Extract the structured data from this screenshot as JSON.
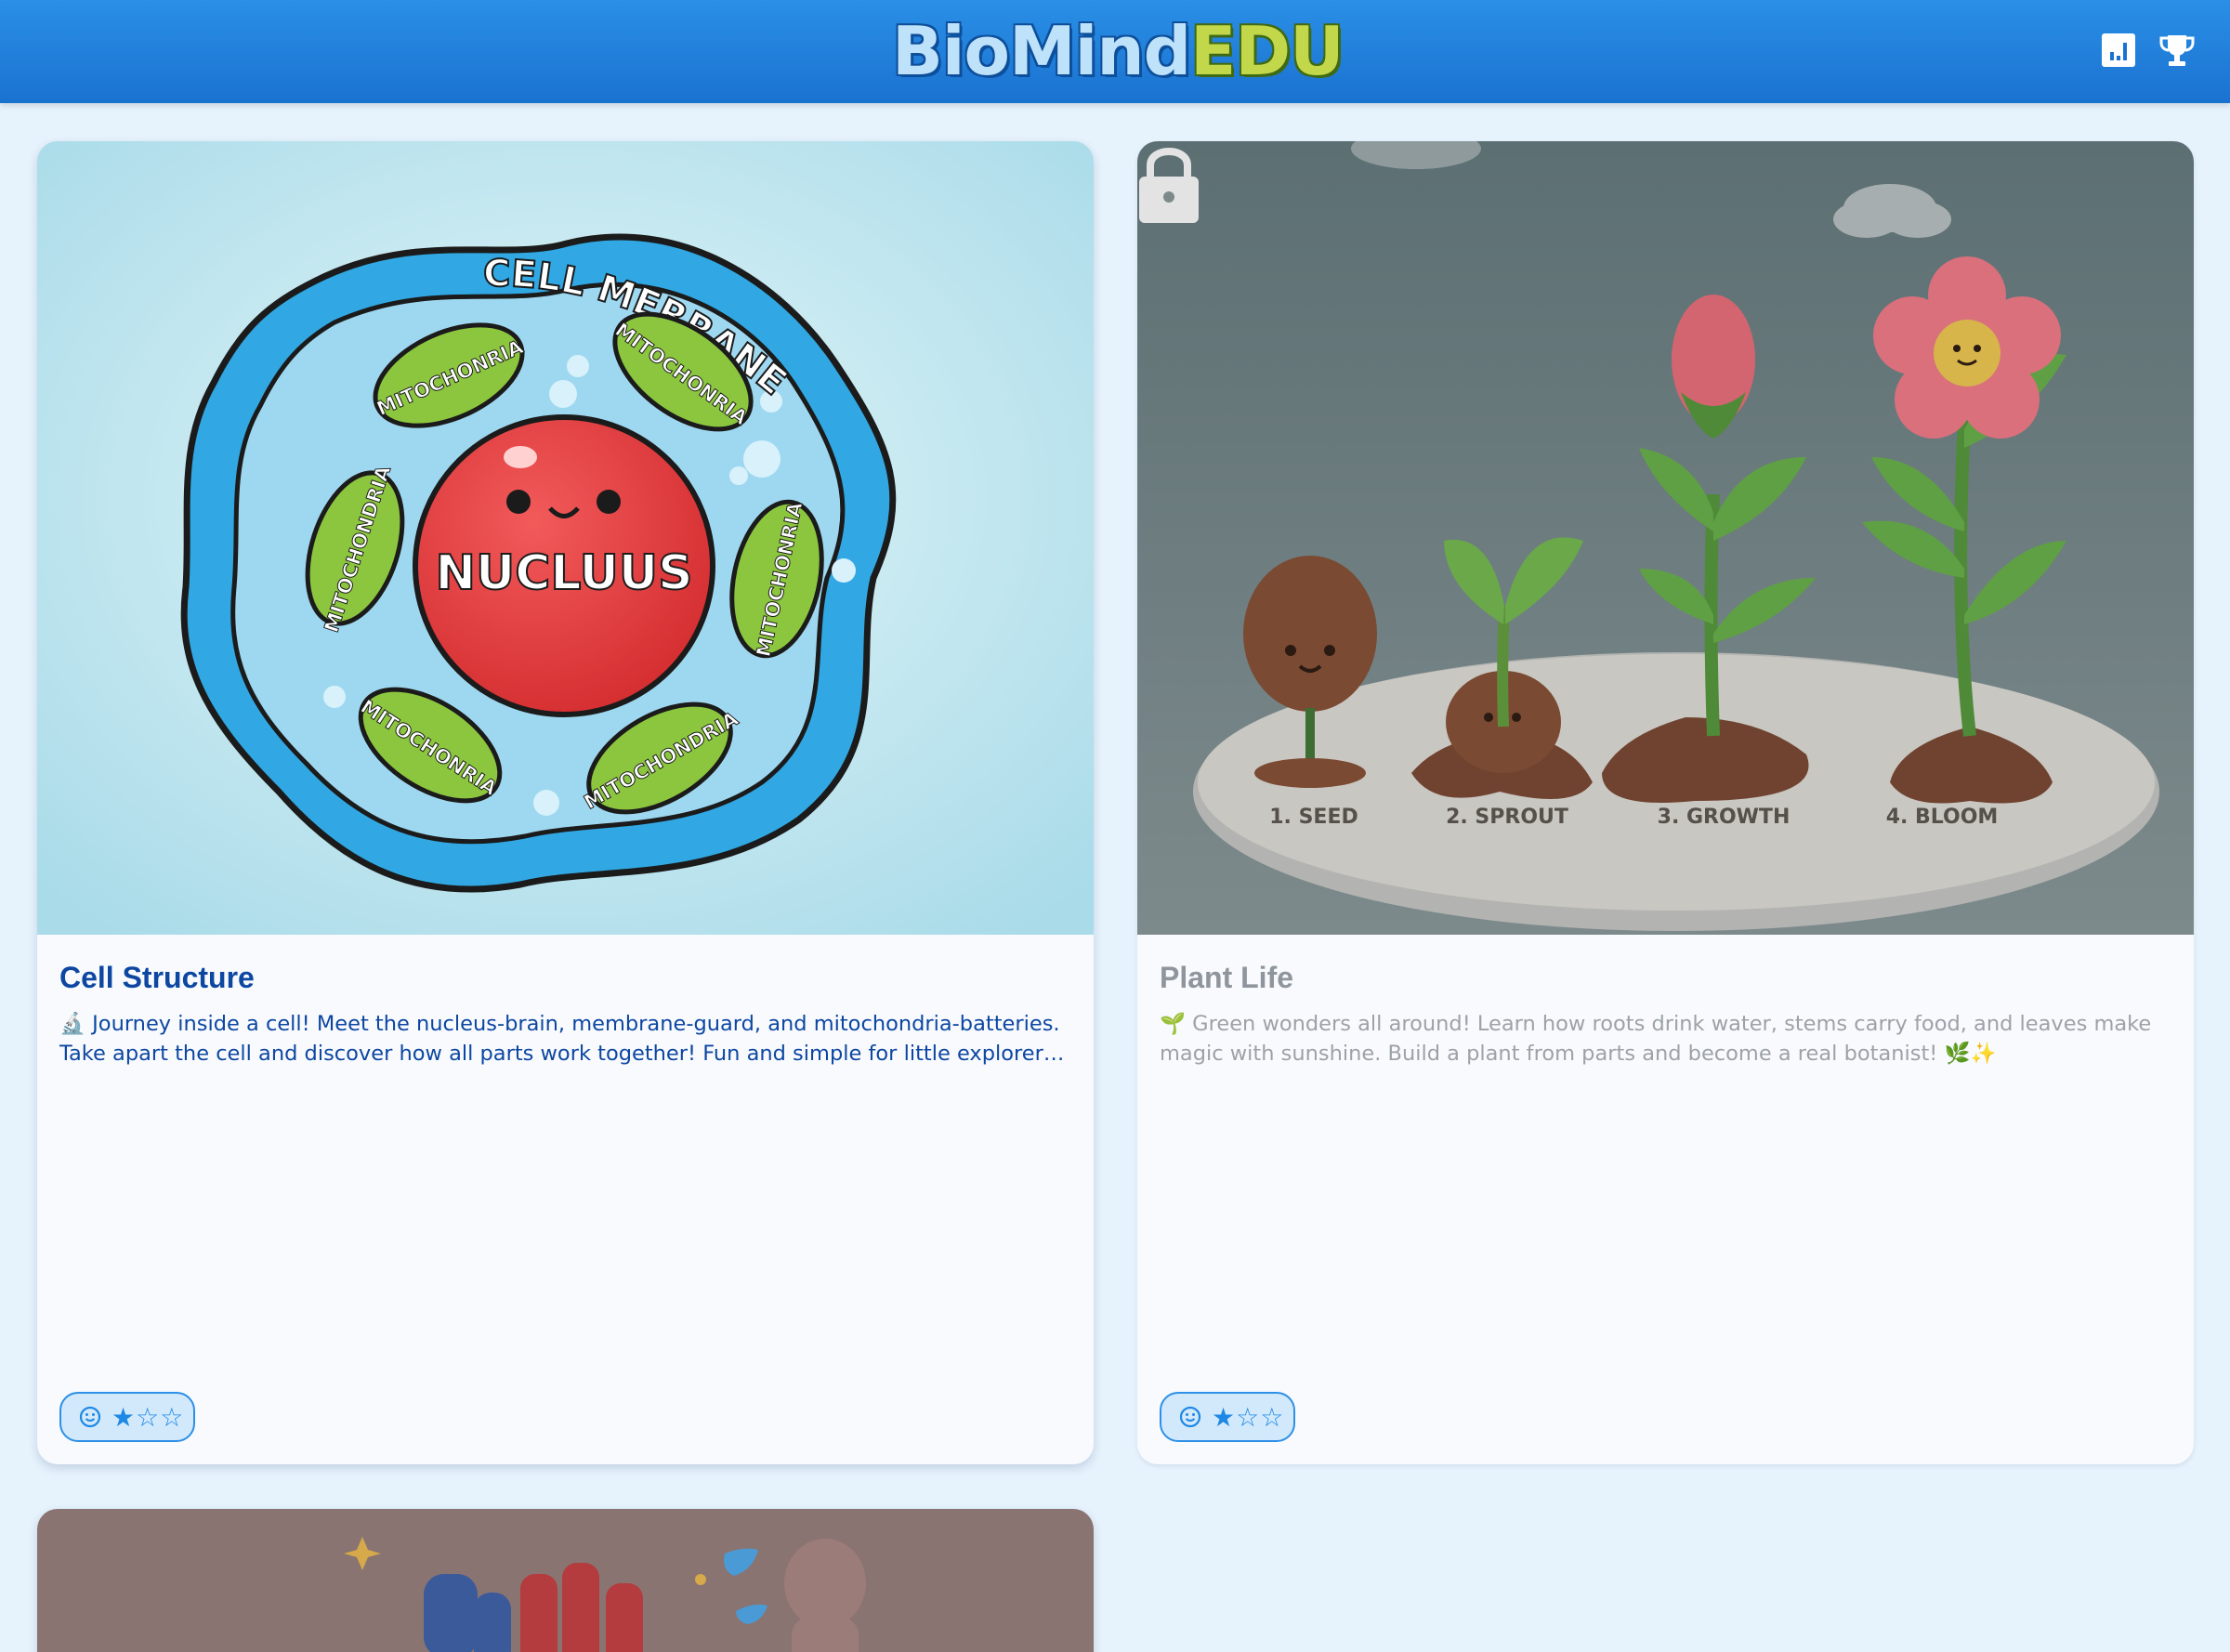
{
  "app": {
    "logo_part1": "BioMind",
    "logo_part2": "EDU",
    "brand_color": "#1e7fdc"
  },
  "header": {
    "icons": [
      "bar-chart-icon",
      "trophy-icon"
    ]
  },
  "cards": [
    {
      "title": "Cell Structure",
      "description": "🔬 Journey inside a cell! Meet the nucleus-brain, membrane-guard, and mitochondria-batteries. Take apart the cell and discover how all parts work together! Fun and simple for little explorer…",
      "difficulty_stars": "★☆☆",
      "locked": false,
      "image_labels": {
        "membrane": "CELL MERRANE",
        "nucleus": "NUCLUUS",
        "mitochondria": "MITOCHONRIA",
        "mitochondria_alt": "MITOCHONDRIA"
      }
    },
    {
      "title": "Plant Life",
      "description": "🌱 Green wonders all around! Learn how roots drink water, stems carry food, and leaves make magic with sunshine. Build a plant from parts and become a real botanist! 🌿✨",
      "difficulty_stars": "★☆☆",
      "locked": true,
      "image_labels": {
        "stage1": "1. SEED",
        "stage2": "2. SPROUT",
        "stage3": "3. GROWTH",
        "stage4": "4. BLOOM"
      }
    },
    {
      "locked": true
    }
  ]
}
